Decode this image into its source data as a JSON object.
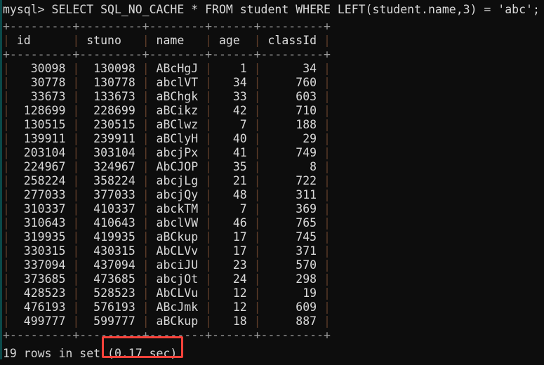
{
  "terminal": {
    "prompt": "mysql> ",
    "query": "SELECT SQL_NO_CACHE * FROM student WHERE LEFT(student.name,3) = 'abc';",
    "prompt_line": "mysql> SELECT SQL_NO_CACHE * FROM student WHERE LEFT(student.name,3) = 'abc';",
    "background_color": "#0d0d0d",
    "text_color": "#d6d6d6"
  },
  "annotation": {
    "type": "red-rectangle-highlight",
    "target_text": "(0.17 sec)",
    "color": "#f9423a"
  },
  "result_table": {
    "columns": [
      {
        "name": "id",
        "width": 9,
        "align": "right"
      },
      {
        "name": "stuno",
        "width": 9,
        "align": "right"
      },
      {
        "name": "name",
        "width": 8,
        "align": "left"
      },
      {
        "name": "age",
        "width": 6,
        "align": "right"
      },
      {
        "name": "classId",
        "width": 9,
        "align": "right"
      }
    ],
    "rule_top": "+---------+---------+--------+------+---------+",
    "rule_mid": "+---------+---------+--------+------+---------+",
    "rule_bottom": "+---------+---------+--------+------+---------+",
    "rows": [
      {
        "id": "30098",
        "stuno": "130098",
        "name": "ABcHgJ",
        "age": "1",
        "classId": "34"
      },
      {
        "id": "30778",
        "stuno": "130778",
        "name": "abclVT",
        "age": "34",
        "classId": "760"
      },
      {
        "id": "33673",
        "stuno": "133673",
        "name": "aBChgk",
        "age": "33",
        "classId": "603"
      },
      {
        "id": "128699",
        "stuno": "228699",
        "name": "aBCikz",
        "age": "42",
        "classId": "710"
      },
      {
        "id": "130515",
        "stuno": "230515",
        "name": "aBClwz",
        "age": "7",
        "classId": "188"
      },
      {
        "id": "139911",
        "stuno": "239911",
        "name": "aBClyH",
        "age": "40",
        "classId": "29"
      },
      {
        "id": "203104",
        "stuno": "303104",
        "name": "abcjPx",
        "age": "41",
        "classId": "749"
      },
      {
        "id": "224967",
        "stuno": "324967",
        "name": "AbCJOP",
        "age": "35",
        "classId": "8"
      },
      {
        "id": "258224",
        "stuno": "358224",
        "name": "abcjLg",
        "age": "21",
        "classId": "722"
      },
      {
        "id": "277033",
        "stuno": "377033",
        "name": "abcjQy",
        "age": "48",
        "classId": "311"
      },
      {
        "id": "310337",
        "stuno": "410337",
        "name": "abckTM",
        "age": "7",
        "classId": "369"
      },
      {
        "id": "310643",
        "stuno": "410643",
        "name": "abclVW",
        "age": "46",
        "classId": "765"
      },
      {
        "id": "319935",
        "stuno": "419935",
        "name": "aBCkup",
        "age": "17",
        "classId": "745"
      },
      {
        "id": "330315",
        "stuno": "430315",
        "name": "AbCLVv",
        "age": "17",
        "classId": "371"
      },
      {
        "id": "337094",
        "stuno": "437094",
        "name": "abciJU",
        "age": "23",
        "classId": "570"
      },
      {
        "id": "373685",
        "stuno": "473685",
        "name": "abcjOt",
        "age": "24",
        "classId": "298"
      },
      {
        "id": "428523",
        "stuno": "528523",
        "name": "AbCLVu",
        "age": "12",
        "classId": "19"
      },
      {
        "id": "476193",
        "stuno": "576193",
        "name": "ABcJmk",
        "age": "12",
        "classId": "609"
      },
      {
        "id": "499777",
        "stuno": "599777",
        "name": "aBCkup",
        "age": "18",
        "classId": "887"
      }
    ]
  },
  "status": {
    "row_count": "19",
    "rows_text": "19 rows in set ",
    "duration": "(0.17 sec)",
    "full_text": "19 rows in set (0.17 sec)"
  }
}
